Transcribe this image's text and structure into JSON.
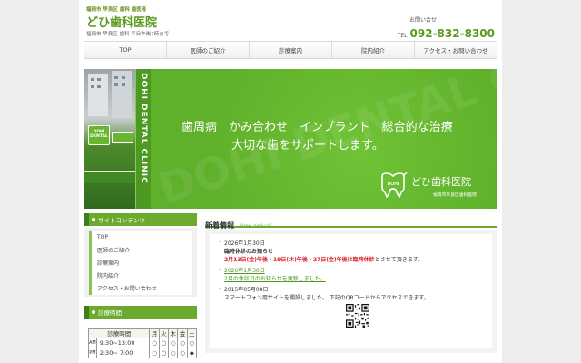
{
  "header": {
    "tag": "福岡市 早良区 歯科 歯医者",
    "title": "どひ歯科医院",
    "subtitle": "福岡市 早良区 歯科 平日午後7時まで",
    "contact_label": "お問い合せ",
    "tel_prefix": "TEL",
    "tel_number": "092-832-8300"
  },
  "nav": {
    "items": [
      "TOP",
      "医師のご紹介",
      "診療案内",
      "院内紹介",
      "アクセス・お問い合わせ"
    ]
  },
  "hero": {
    "vertical_text": "DOHI DENTAL CLINIC",
    "tagline1": "歯周病　かみ合わせ　インプラント　総合的な治療",
    "tagline2": "大切な歯をサポートします。",
    "sign_line1": "DOHI",
    "sign_line2": "DENTAL",
    "clinic_name": "どひ歯科医院",
    "address": "福岡市早良区歯科医院"
  },
  "sidebar": {
    "contents_heading": "サイトコンテンツ",
    "items": [
      "TOP",
      "医師のご紹介",
      "診療案内",
      "院内紹介",
      "アクセス・お問い合わせ"
    ],
    "hours_heading": "診療時間",
    "hours": {
      "headers": [
        "診療時間",
        "月",
        "火",
        "木",
        "金",
        "土"
      ],
      "rows": [
        {
          "ampm": "AM",
          "time": "9:30~13:00",
          "marks": [
            "○",
            "○",
            "○",
            "○",
            "○"
          ]
        },
        {
          "ampm": "PM",
          "time": "2:30~ 7:00",
          "marks": [
            "○",
            "○",
            "○",
            "○",
            "◆"
          ]
        }
      ]
    }
  },
  "news": {
    "title": "新着情報",
    "title_en": "New arrival",
    "items": [
      {
        "date": "2026年1月30日",
        "headline": "臨時休診のお知らせ",
        "detail_red": "2月13日(金)午後・19日(木)午後・27日(金)午後は臨時休診",
        "detail_rest": "とさせて頂きます。"
      },
      {
        "date": "2026年1月30日",
        "link_text": "2月の休診日のお知らせを更新しました。"
      },
      {
        "date": "2015年05月08日",
        "text": "スマートフォン用サイトを開設しました。 下記のQRコードからアクセスできます。"
      }
    ]
  }
}
